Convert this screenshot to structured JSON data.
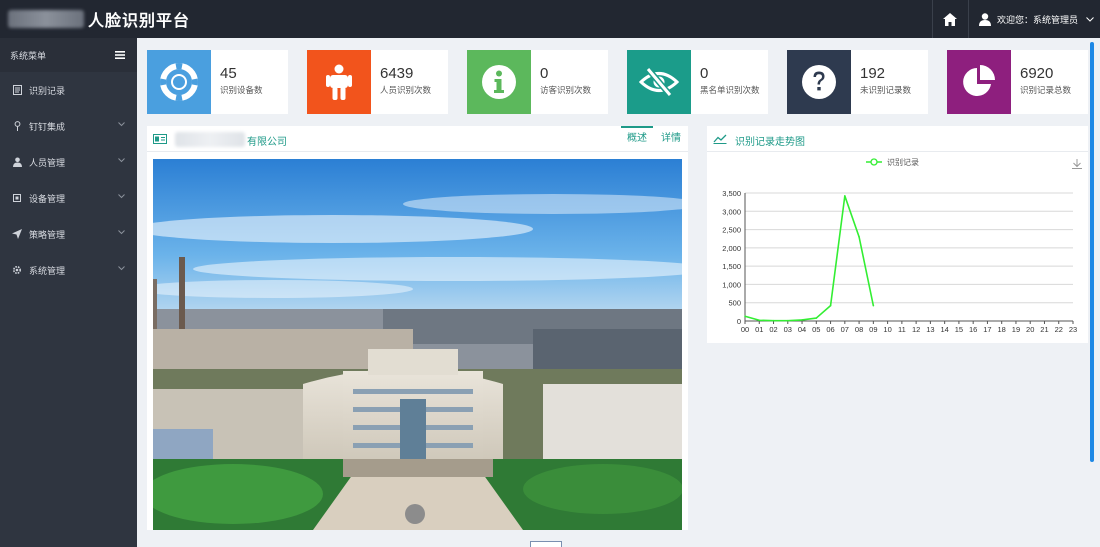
{
  "header": {
    "app_title": "人脸识别平台",
    "welcome": "欢迎您：系统管理员"
  },
  "sidebar": {
    "title": "系统菜单",
    "items": [
      {
        "label": "识别记录",
        "icon": "document-icon"
      },
      {
        "label": "钉钉集成",
        "icon": "pin-icon"
      },
      {
        "label": "人员管理",
        "icon": "user-icon"
      },
      {
        "label": "设备管理",
        "icon": "device-icon"
      },
      {
        "label": "策略管理",
        "icon": "send-icon"
      },
      {
        "label": "系统管理",
        "icon": "gear-icon"
      }
    ]
  },
  "stats": [
    {
      "value": "45",
      "label": "识别设备数",
      "color": "#4a9fdf",
      "icon": "lifebuoy-icon"
    },
    {
      "value": "6439",
      "label": "人员识别次数",
      "color": "#f2541c",
      "icon": "person-icon"
    },
    {
      "value": "0",
      "label": "访客识别次数",
      "color": "#5cb85c",
      "icon": "info-icon"
    },
    {
      "value": "0",
      "label": "黑名单识别次数",
      "color": "#1b9c8a",
      "icon": "eye-slash-icon"
    },
    {
      "value": "192",
      "label": "未识别记录数",
      "color": "#2e3a4f",
      "icon": "question-icon"
    },
    {
      "value": "6920",
      "label": "识别记录总数",
      "color": "#8e1f7e",
      "icon": "pie-icon"
    }
  ],
  "company_panel": {
    "name": "有限公司",
    "tabs": [
      "概述",
      "详情"
    ],
    "active_tab": "概述"
  },
  "trend_panel": {
    "title": "识别记录走势图"
  },
  "chart_data": {
    "type": "line",
    "title": "",
    "legend": [
      "识别记录"
    ],
    "legend_position": "top-center",
    "x": [
      "00",
      "01",
      "02",
      "03",
      "04",
      "05",
      "06",
      "07",
      "08",
      "09",
      "10",
      "11",
      "12",
      "13",
      "14",
      "15",
      "16",
      "17",
      "18",
      "19",
      "20",
      "21",
      "22",
      "23"
    ],
    "series": [
      {
        "name": "识别记录",
        "values": [
          130,
          20,
          10,
          10,
          30,
          80,
          420,
          3420,
          2300,
          420,
          null,
          null,
          null,
          null,
          null,
          null,
          null,
          null,
          null,
          null,
          null,
          null,
          null,
          null
        ]
      }
    ],
    "ylim": [
      0,
      3500
    ],
    "yticks": [
      "0",
      "500",
      "1,000",
      "1,500",
      "2,000",
      "2,500",
      "3,000",
      "3,500"
    ],
    "grid": true,
    "line_color": "#33ee33"
  }
}
